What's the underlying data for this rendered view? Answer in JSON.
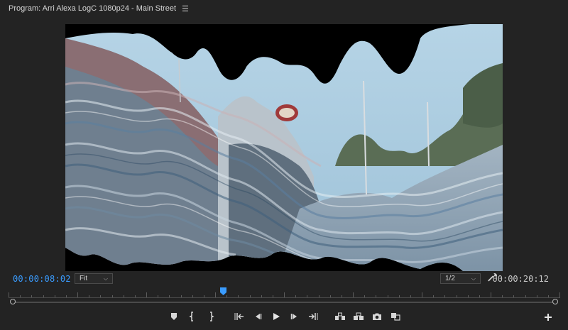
{
  "panel": {
    "title": "Program: Arri Alexa LogC 1080p24 - Main Street",
    "menu_icon": "hamburger-menu-icon"
  },
  "timecode": {
    "current": "00:00:08:02",
    "duration": "00:00:20:12"
  },
  "zoom": {
    "selected": "Fit"
  },
  "resolution": {
    "selected": "1/2"
  },
  "playhead_position": 0.39,
  "colors": {
    "accent": "#3a9cff",
    "background": "#232323",
    "text": "#cfcfcf"
  },
  "transport": [
    {
      "name": "add-marker-button",
      "icon": "marker-icon"
    },
    {
      "name": "mark-in-button",
      "icon": "mark-in-icon"
    },
    {
      "name": "mark-out-button",
      "icon": "mark-out-icon"
    },
    {
      "name": "go-to-in-button",
      "icon": "go-to-in-icon"
    },
    {
      "name": "step-back-button",
      "icon": "step-back-icon"
    },
    {
      "name": "play-button",
      "icon": "play-icon"
    },
    {
      "name": "step-forward-button",
      "icon": "step-forward-icon"
    },
    {
      "name": "go-to-out-button",
      "icon": "go-to-out-icon"
    },
    {
      "name": "lift-button",
      "icon": "lift-icon"
    },
    {
      "name": "extract-button",
      "icon": "extract-icon"
    },
    {
      "name": "export-frame-button",
      "icon": "camera-icon"
    },
    {
      "name": "comparison-view-button",
      "icon": "comparison-icon"
    }
  ]
}
